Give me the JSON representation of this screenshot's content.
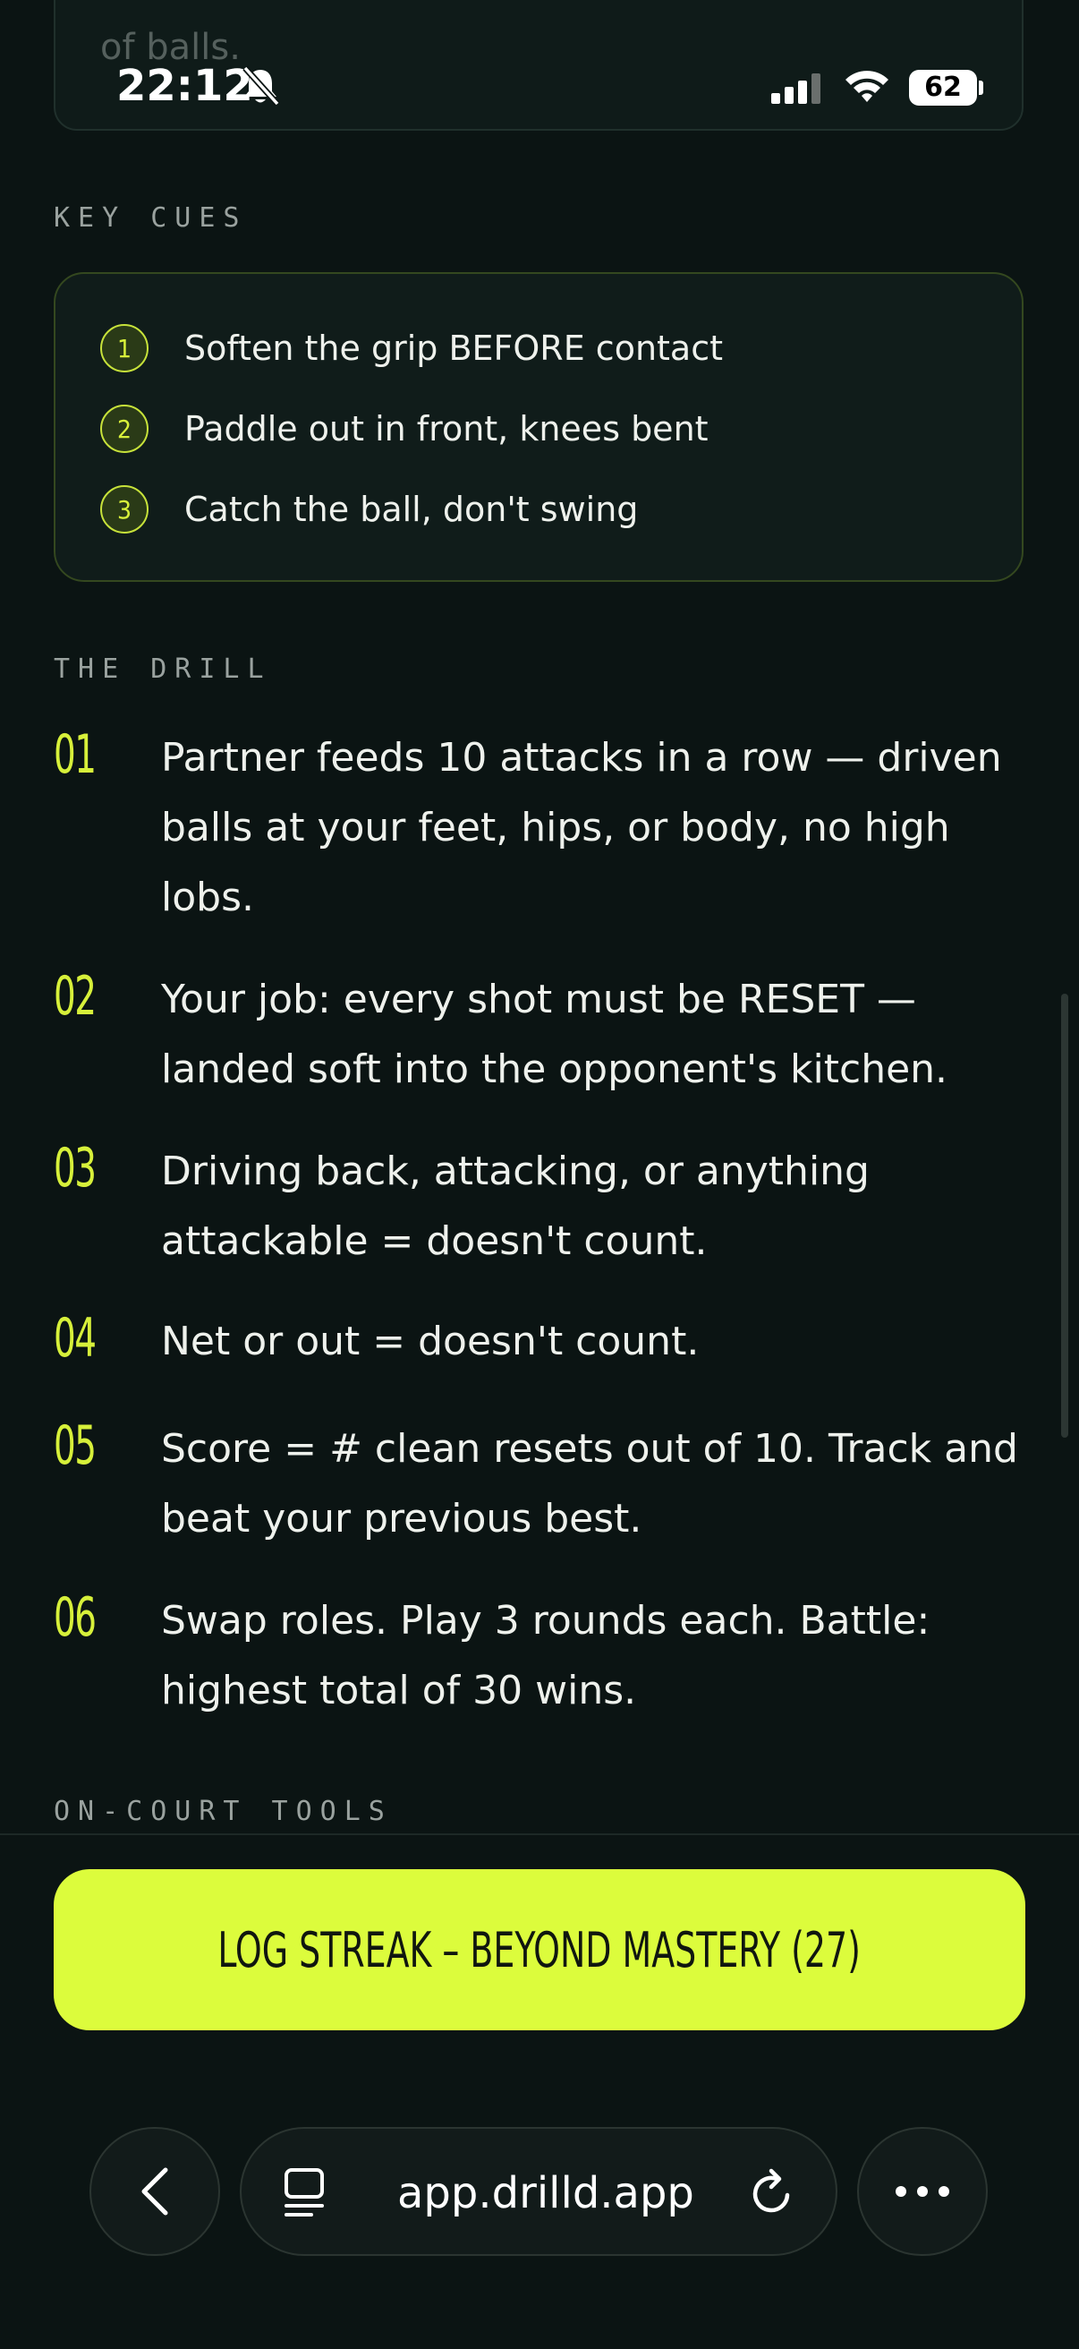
{
  "previous_card": {
    "text": "of balls."
  },
  "status_bar": {
    "time": "22:12",
    "battery": "62"
  },
  "key_cues": {
    "label": "KEY CUES",
    "items": [
      {
        "num": "1",
        "text": "Soften the grip BEFORE contact"
      },
      {
        "num": "2",
        "text": "Paddle out in front, knees bent"
      },
      {
        "num": "3",
        "text": "Catch the ball, don't swing"
      }
    ]
  },
  "drill": {
    "label": "THE DRILL",
    "steps": [
      {
        "num": "01",
        "text": "Partner feeds 10 attacks in a row — driven balls at your feet, hips, or body, no high lobs."
      },
      {
        "num": "02",
        "text": "Your job: every shot must be RESET — landed soft into the opponent's kitchen."
      },
      {
        "num": "03",
        "text": "Driving back, attacking, or anything attackable = doesn't count."
      },
      {
        "num": "04",
        "text": "Net or out = doesn't count."
      },
      {
        "num": "05",
        "text": "Score = # clean resets out of 10. Track and beat your previous best."
      },
      {
        "num": "06",
        "text": "Swap roles. Play 3 rounds each. Battle: highest total of 30 wins."
      }
    ]
  },
  "tools": {
    "label": "ON-COURT TOOLS"
  },
  "cta": {
    "label": "LOG STREAK – BEYOND MASTERY (27)"
  },
  "browser": {
    "url": "app.drilld.app"
  },
  "colors": {
    "accent": "#dcfc3c",
    "background": "#0b1413",
    "text": "#eef1ec"
  }
}
